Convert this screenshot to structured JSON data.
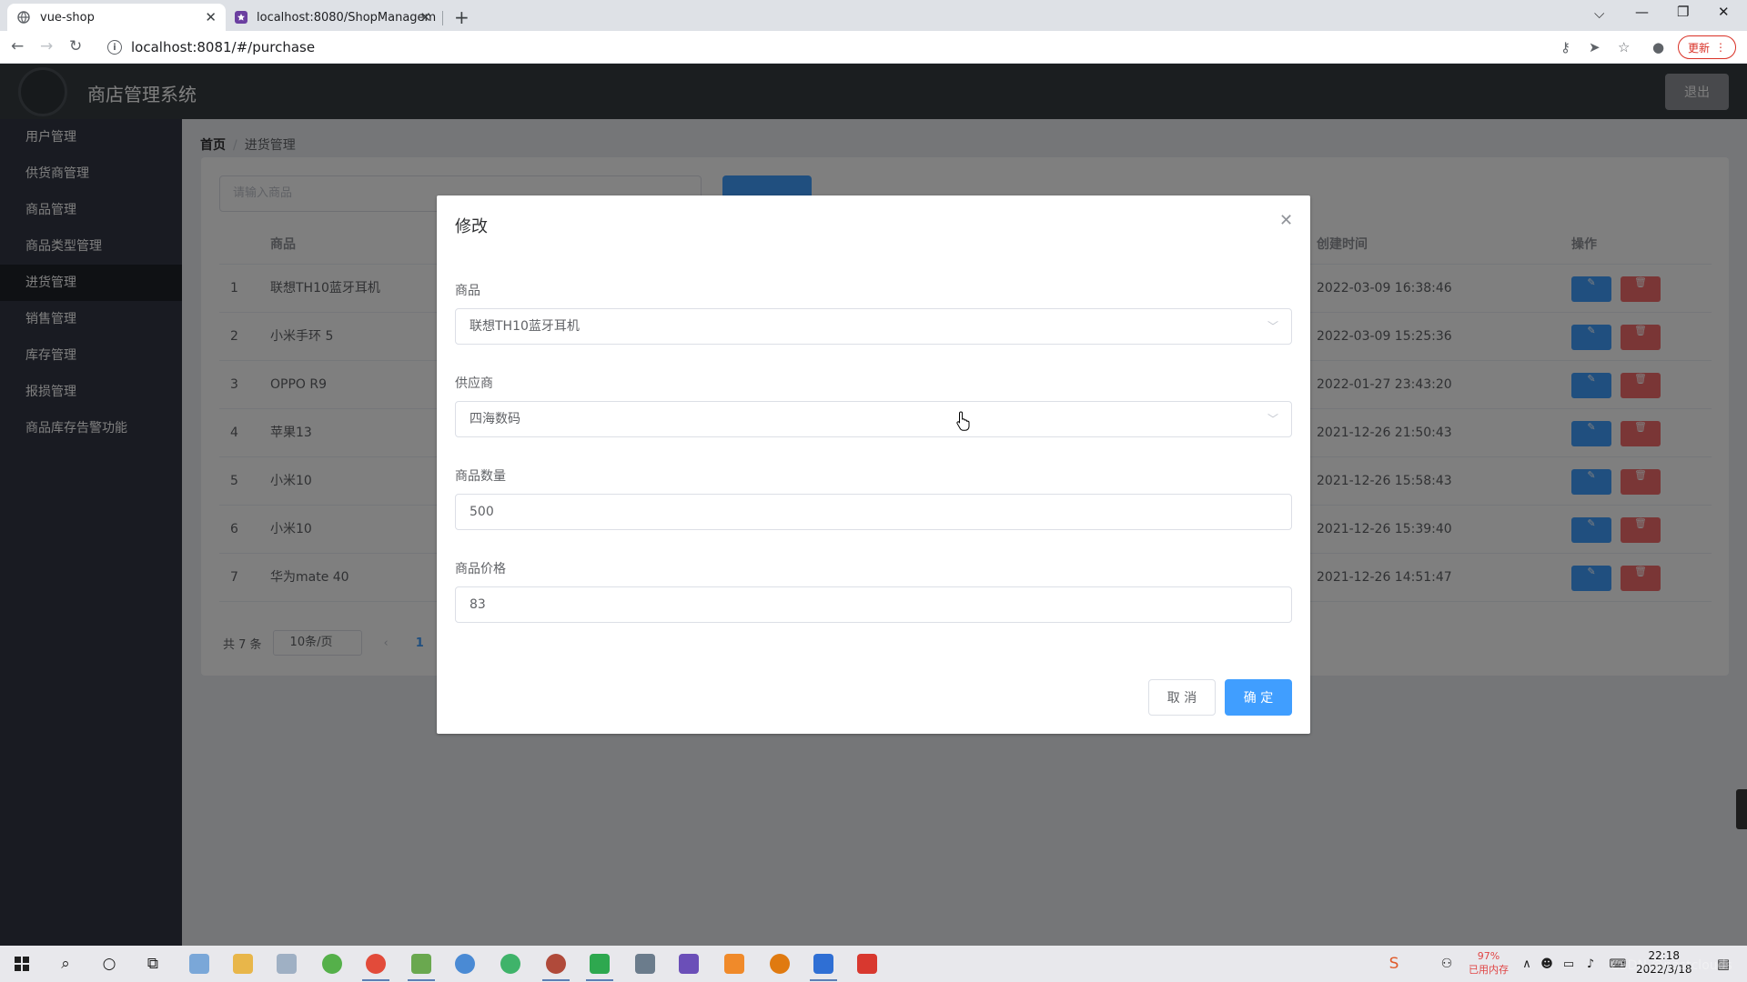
{
  "browser": {
    "tabs": [
      {
        "title": "vue-shop"
      },
      {
        "title": "localhost:8080/ShopManagem"
      }
    ],
    "url": "localhost:8081/#/purchase",
    "update_label": "更新"
  },
  "app": {
    "title": "商店管理系统",
    "logout_label": "退出"
  },
  "sidebar": {
    "items": [
      {
        "label": "用户管理"
      },
      {
        "label": "供货商管理"
      },
      {
        "label": "商品管理"
      },
      {
        "label": "商品类型管理"
      },
      {
        "label": "进货管理",
        "active": true
      },
      {
        "label": "销售管理"
      },
      {
        "label": "库存管理"
      },
      {
        "label": "报损管理"
      },
      {
        "label": "商品库存告警功能"
      }
    ]
  },
  "breadcrumb": {
    "home": "首页",
    "current": "进货管理"
  },
  "search": {
    "placeholder": "请输入商品"
  },
  "table": {
    "headers": {
      "goods": "商品",
      "created": "创建时间",
      "actions": "操作"
    },
    "rows": [
      {
        "index": "1",
        "goods": "联想TH10蓝牙耳机",
        "created": "2022-03-09 16:38:46"
      },
      {
        "index": "2",
        "goods": "小米手环 5",
        "created": "2022-03-09 15:25:36"
      },
      {
        "index": "3",
        "goods": "OPPO R9",
        "created": "2022-01-27 23:43:20"
      },
      {
        "index": "4",
        "goods": "苹果13",
        "created": "2021-12-26 21:50:43"
      },
      {
        "index": "5",
        "goods": "小米10",
        "created": "2021-12-26 15:58:43"
      },
      {
        "index": "6",
        "goods": "小米10",
        "created": "2021-12-26 15:39:40"
      },
      {
        "index": "7",
        "goods": "华为mate 40",
        "created": "2021-12-26 14:51:47"
      }
    ]
  },
  "pagination": {
    "total": "共 7 条",
    "page_size": "10条/页",
    "current_page": "1"
  },
  "dialog": {
    "title": "修改",
    "fields": {
      "goods": {
        "label": "商品",
        "value": "联想TH10蓝牙耳机"
      },
      "supplier": {
        "label": "供应商",
        "value": "四海数码"
      },
      "quantity": {
        "label": "商品数量",
        "value": "500"
      },
      "price": {
        "label": "商品价格",
        "value": "83"
      }
    },
    "cancel_label": "取 消",
    "confirm_label": "确 定"
  },
  "taskbar": {
    "memory_percent": "97%",
    "memory_label": "已用内存",
    "time": "22:18",
    "date": "2022/3/18",
    "watermark": "CSDN @nastclouds"
  },
  "colors": {
    "primary": "#409eff",
    "danger": "#f56c6c",
    "sidebar": "#333744",
    "header": "#373d41"
  }
}
